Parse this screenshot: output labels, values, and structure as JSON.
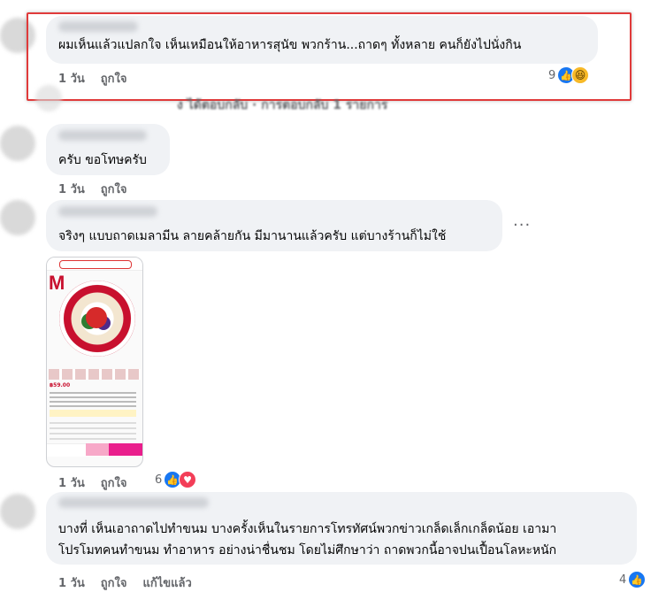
{
  "comments": [
    {
      "text": "ผมเห็นแล้วแปลกใจ เห็นเหมือนให้อาหารสุนัข พวกร้าน...ถาดๆ ทั้งหลาย คนก็ยังไปนั่งกิน",
      "time": "1 วัน",
      "like": "ถูกใจ",
      "reaction_count": "9"
    },
    {
      "replies_blurred": "ง ได้ตอบกลับ · การตอบกลับ 1 รายการ"
    },
    {
      "text": "ครับ ขอโทษครับ",
      "time": "1 วัน",
      "like": "ถูกใจ"
    },
    {
      "text": "จริงๆ แบบถาดเมลามีน ลายคล้ายกัน มีมานานแล้วครับ แต่บางร้านก็ไม่ใช้",
      "time": "1 วัน",
      "like": "ถูกใจ",
      "reaction_count": "6",
      "more": "···",
      "screenshot": {
        "price": "฿59.00"
      }
    },
    {
      "text_line1": "บางที่ เห็นเอาถาดไปทำขนม บางครั้งเห็นในรายการโทรทัศน์พวกข่าวเกล็ดเล็กเกล็ดน้อย เอามา",
      "text_line2": "โปรโมทคนทำขนม ทำอาหาร อย่างน่าชื่นชม โดยไม่ศึกษาว่า ถาดพวกนี้อาจปนเปื้อนโลหะหนัก",
      "time": "1 วัน",
      "like": "ถูกใจ",
      "edited": "แก้ไขแล้ว",
      "reaction_count": "4"
    }
  ],
  "colors": {
    "like": "#1877f2",
    "love": "#f33e58",
    "haha": "#f7b928",
    "highlight": "#e03a3a",
    "bubble": "#f0f2f5"
  },
  "icons": [
    "like-reaction-icon",
    "haha-reaction-icon",
    "love-reaction-icon",
    "more-options-icon"
  ]
}
